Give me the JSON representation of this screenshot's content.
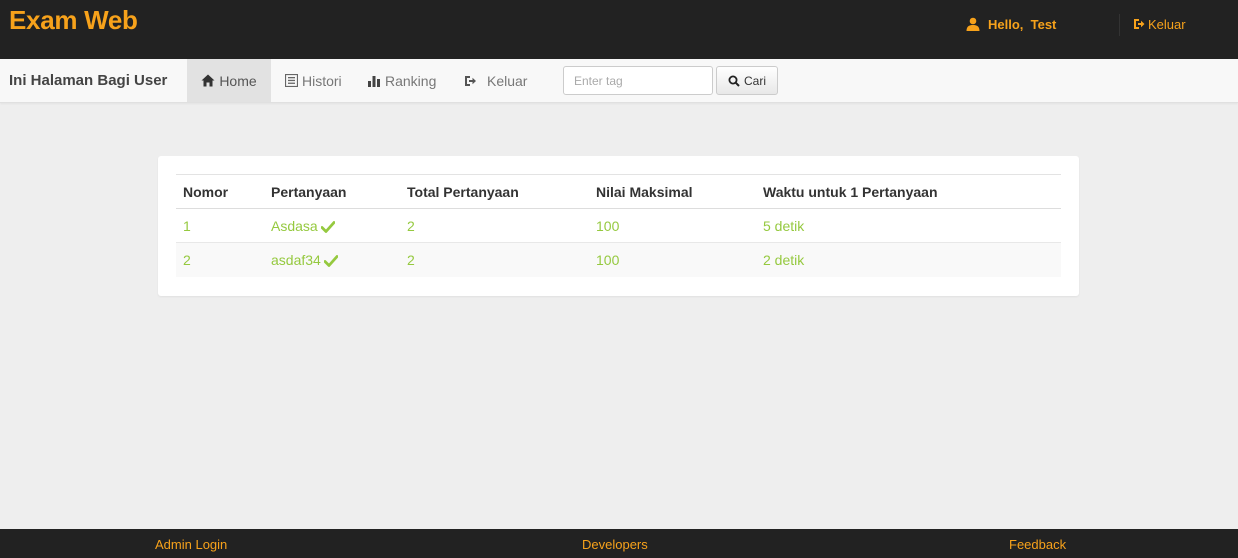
{
  "header": {
    "brand": "Exam Web",
    "greeting": "Hello,  Test",
    "logout_label": "Keluar"
  },
  "navbar": {
    "brand": "Ini Halaman Bagi User",
    "items": [
      {
        "label": "Home",
        "icon": "home-icon",
        "active": true
      },
      {
        "label": "Histori",
        "icon": "list-icon"
      },
      {
        "label": "Ranking",
        "icon": "ranking-icon"
      },
      {
        "label": "Keluar",
        "icon": "logout-icon"
      }
    ],
    "search": {
      "placeholder": "Enter tag",
      "value": ""
    },
    "search_button": "Cari"
  },
  "table": {
    "headers": [
      "Nomor",
      "Pertanyaan",
      "Total Pertanyaan",
      "Nilai Maksimal",
      "Waktu untuk 1 Pertanyaan"
    ],
    "rows": [
      {
        "nomor": "1",
        "pertanyaan": "Asdasa",
        "total": "2",
        "nilai": "100",
        "waktu": "5 detik"
      },
      {
        "nomor": "2",
        "pertanyaan": "asdaf34",
        "total": "2",
        "nilai": "100",
        "waktu": "2 detik"
      }
    ]
  },
  "footer": {
    "admin_login": "Admin Login",
    "developers": "Developers",
    "feedback": "Feedback"
  },
  "colors": {
    "accent": "#f7a21b",
    "dark_bar": "#222222",
    "link_green": "#95c93f"
  }
}
